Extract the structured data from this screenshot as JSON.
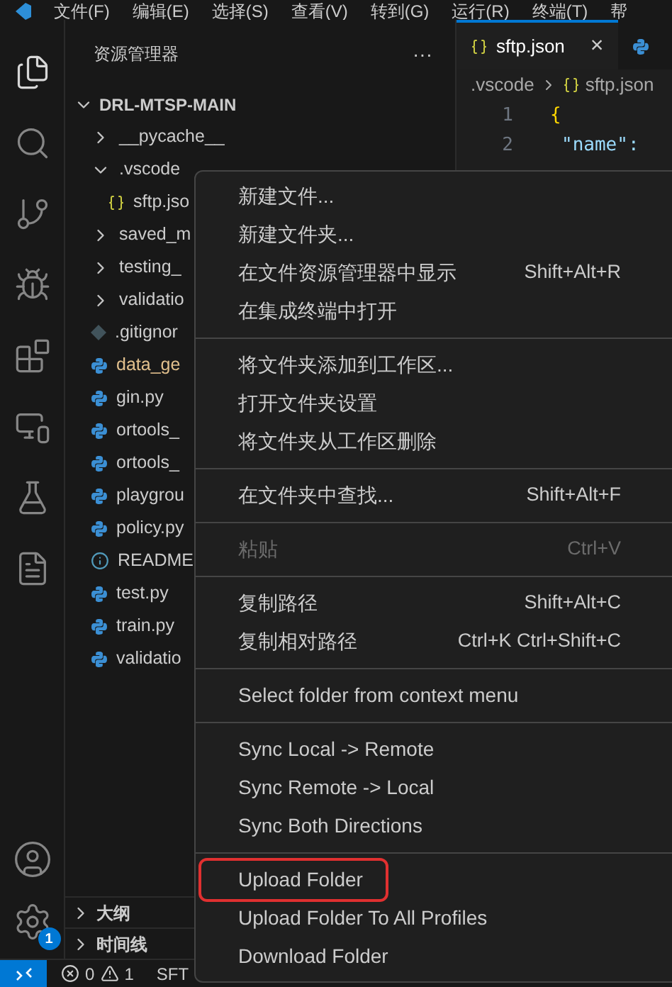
{
  "menu_bar": [
    "文件(F)",
    "编辑(E)",
    "选择(S)",
    "查看(V)",
    "转到(G)",
    "运行(R)",
    "终端(T)",
    "帮"
  ],
  "activity_bar": {
    "items": [
      {
        "kind": "explorer",
        "selected": true
      },
      {
        "kind": "search",
        "selected": false
      },
      {
        "kind": "source-control",
        "selected": false
      },
      {
        "kind": "debug",
        "selected": false
      },
      {
        "kind": "extensions",
        "selected": false
      },
      {
        "kind": "remote",
        "selected": false
      },
      {
        "kind": "testing",
        "selected": false
      },
      {
        "kind": "sftp",
        "selected": false
      }
    ],
    "settings_badge": "1"
  },
  "explorer": {
    "title": "资源管理器",
    "more": "···",
    "root": {
      "label": "DRL-MTSP-MAIN",
      "expanded": true,
      "children": [
        {
          "label": "__pycache__",
          "kind": "folder",
          "expanded": false
        },
        {
          "label": ".vscode",
          "kind": "folder",
          "expanded": true,
          "children": [
            {
              "label": "sftp.jso",
              "kind": "json",
              "modified": false
            }
          ]
        },
        {
          "label": "saved_m",
          "kind": "folder",
          "expanded": false
        },
        {
          "label": "testing_",
          "kind": "folder",
          "expanded": false
        },
        {
          "label": "validatio",
          "kind": "folder",
          "expanded": false
        },
        {
          "label": ".gitignor",
          "kind": "git",
          "modified": false
        },
        {
          "label": "data_ge",
          "kind": "python",
          "modified": true
        },
        {
          "label": "gin.py",
          "kind": "python",
          "modified": false
        },
        {
          "label": "ortools_",
          "kind": "python",
          "modified": false
        },
        {
          "label": "ortools_",
          "kind": "python",
          "modified": false
        },
        {
          "label": "playgrou",
          "kind": "python",
          "modified": false
        },
        {
          "label": "policy.py",
          "kind": "python",
          "modified": false
        },
        {
          "label": "README",
          "kind": "info",
          "modified": false
        },
        {
          "label": "test.py",
          "kind": "python",
          "modified": false
        },
        {
          "label": "train.py",
          "kind": "python",
          "modified": false
        },
        {
          "label": "validatio",
          "kind": "python",
          "modified": false
        }
      ]
    }
  },
  "panels": [
    {
      "label": "大纲",
      "expanded": false
    },
    {
      "label": "时间线",
      "expanded": false
    }
  ],
  "editor": {
    "tabs": [
      {
        "label": "sftp.json",
        "kind": "json",
        "selected": true,
        "close": "×"
      },
      {
        "kind": "python",
        "selected": false
      }
    ],
    "breadcrumb": [
      {
        "label": ".vscode",
        "kind": "folder"
      },
      {
        "label": "sftp.json",
        "kind": "json"
      }
    ],
    "lines": [
      {
        "number": "1",
        "text": "{",
        "kind": "brace"
      },
      {
        "number": "2",
        "text": "\"name\":",
        "kind": "key"
      }
    ]
  },
  "context_menu": {
    "items": [
      {
        "kind": "item",
        "label": "新建文件...",
        "disabled": false,
        "highlighted": false
      },
      {
        "kind": "item",
        "label": "新建文件夹...",
        "disabled": false,
        "highlighted": false
      },
      {
        "kind": "item",
        "label": "在文件资源管理器中显示",
        "shortcut": "Shift+Alt+R",
        "disabled": false,
        "highlighted": false
      },
      {
        "kind": "item",
        "label": "在集成终端中打开",
        "disabled": false,
        "highlighted": false
      },
      {
        "kind": "separator"
      },
      {
        "kind": "item",
        "label": "将文件夹添加到工作区...",
        "disabled": false,
        "highlighted": false
      },
      {
        "kind": "item",
        "label": "打开文件夹设置",
        "disabled": false,
        "highlighted": false
      },
      {
        "kind": "item",
        "label": "将文件夹从工作区删除",
        "disabled": false,
        "highlighted": false
      },
      {
        "kind": "separator"
      },
      {
        "kind": "item",
        "label": "在文件夹中查找...",
        "shortcut": "Shift+Alt+F",
        "disabled": false,
        "highlighted": false
      },
      {
        "kind": "separator"
      },
      {
        "kind": "item",
        "label": "粘贴",
        "shortcut": "Ctrl+V",
        "disabled": true,
        "highlighted": false
      },
      {
        "kind": "separator"
      },
      {
        "kind": "item",
        "label": "复制路径",
        "shortcut": "Shift+Alt+C",
        "disabled": false,
        "highlighted": false
      },
      {
        "kind": "item",
        "label": "复制相对路径",
        "shortcut": "Ctrl+K Ctrl+Shift+C",
        "disabled": false,
        "highlighted": false
      },
      {
        "kind": "separator"
      },
      {
        "kind": "item",
        "label": "Select folder from context menu",
        "disabled": false,
        "highlighted": false
      },
      {
        "kind": "separator"
      },
      {
        "kind": "item",
        "label": "Sync Local -> Remote",
        "disabled": false,
        "highlighted": false
      },
      {
        "kind": "item",
        "label": "Sync Remote -> Local",
        "disabled": false,
        "highlighted": false
      },
      {
        "kind": "item",
        "label": "Sync Both Directions",
        "disabled": false,
        "highlighted": false
      },
      {
        "kind": "separator"
      },
      {
        "kind": "item",
        "label": "Upload Folder",
        "disabled": false,
        "highlighted": true
      },
      {
        "kind": "item",
        "label": "Upload Folder To All Profiles",
        "disabled": false,
        "highlighted": false
      },
      {
        "kind": "item",
        "label": "Download Folder",
        "disabled": false,
        "highlighted": false
      }
    ]
  },
  "status_bar": {
    "errors": "0",
    "warnings": "1",
    "item": "SFT"
  }
}
